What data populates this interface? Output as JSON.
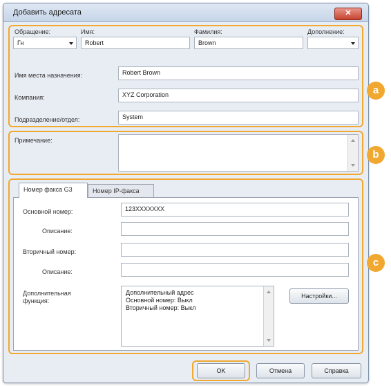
{
  "window": {
    "title": "Добавить адресата",
    "close_label": "✕"
  },
  "name_section": {
    "salutation_label": "Обращение:",
    "salutation_value": "Гн",
    "first_name_label": "Имя:",
    "first_name_value": "Robert",
    "last_name_label": "Фамилия:",
    "last_name_value": "Brown",
    "addition_label": "Дополнение:",
    "addition_value": "",
    "destination_label": "Имя места назначения:",
    "destination_value": "Robert Brown",
    "company_label": "Компания:",
    "company_value": "XYZ Corporation",
    "department_label": "Подразделение/отдел:",
    "department_value": "System"
  },
  "notes": {
    "label": "Примечание:",
    "value": ""
  },
  "tabs": [
    {
      "label": "Номер факса G3",
      "active": true
    },
    {
      "label": "Номер IP-факса",
      "active": false
    }
  ],
  "fax": {
    "main_number_label": "Основной номер:",
    "main_number_value": "123XXXXXXX",
    "description1_label": "Описание:",
    "description1_value": "",
    "secondary_number_label": "Вторичный номер:",
    "secondary_number_value": "",
    "description2_label": "Описание:",
    "description2_value": "",
    "extra_label_line1": "Дополнительная",
    "extra_label_line2": "функция:",
    "extra_lines": [
      "Дополнительный адрес",
      "Основной номер:  Выкл",
      "Вторичный номер: Выкл"
    ],
    "settings_button": "Настройки..."
  },
  "buttons": {
    "ok": "OK",
    "cancel": "Отмена",
    "help": "Справка"
  },
  "callouts": [
    "a",
    "b",
    "c"
  ],
  "colors": {
    "accent": "#f0a830",
    "title_bar": "#c6d5e8",
    "close_button": "#c8422f"
  }
}
